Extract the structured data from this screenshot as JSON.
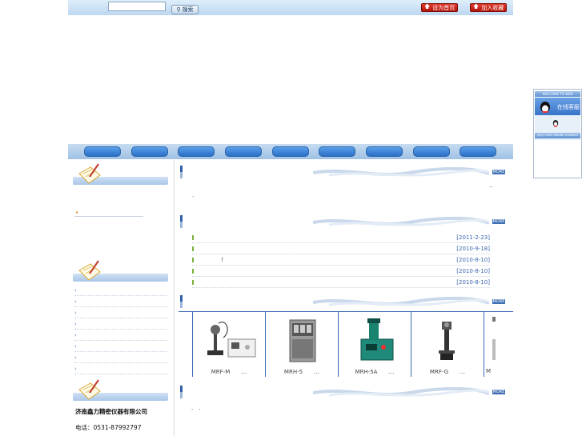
{
  "topbar": {
    "search_placeholder": "",
    "search_label": "搜索",
    "set_home_label": "设为首页",
    "favorite_label": "加入收藏"
  },
  "nav": {
    "items": [
      "",
      "",
      "",
      "",
      "",
      "",
      "",
      "",
      ""
    ]
  },
  "sidebar": {
    "news_bullet": "•",
    "categories": [
      "",
      "",
      "",
      "",
      "",
      "",
      "",
      ""
    ],
    "contact_company": "济南鑫力精密仪器有限公司",
    "contact_phone": "电话：0531-87992797"
  },
  "main": {
    "section1_text": "·",
    "section1_tail": "..",
    "news": [
      {
        "title": "",
        "date": "[2011-2-23]"
      },
      {
        "title": "",
        "date": "[2010-9-18]"
      },
      {
        "title": "！",
        "date": "[2010-8-10]"
      },
      {
        "title": "",
        "date": "[2010-8-10]"
      },
      {
        "title": "",
        "date": "[2010-8-10]"
      }
    ],
    "products": [
      {
        "name": "MRF-M　　…"
      },
      {
        "name": "MRH-5　　…"
      },
      {
        "name": "MRH-5A　　…"
      },
      {
        "name": "MRF-G　　…"
      },
      {
        "name": "M"
      }
    ],
    "section4_text": "·　·",
    "more_label": "MORE"
  },
  "qq": {
    "welcome": "WELCOME TO WEB",
    "online": "在线客服",
    "footer": "QQQ CHAT ONLINE CONSULT"
  },
  "colors": {
    "nav_button": "#2a6fc6",
    "accent_blue": "#3d6cb6",
    "date": "#3a66b0",
    "bullet_green": "#7ab23a"
  }
}
